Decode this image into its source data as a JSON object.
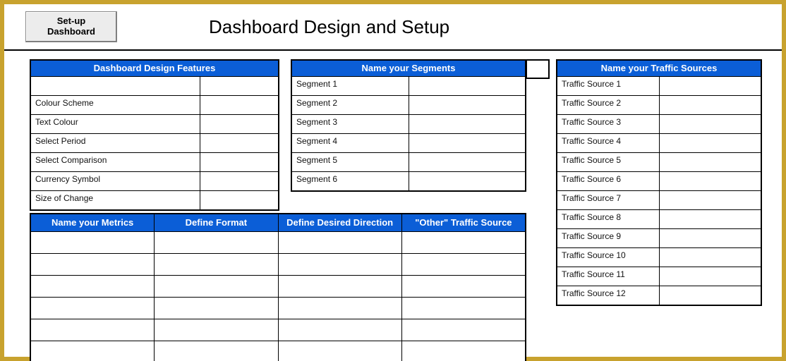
{
  "header": {
    "button_line1": "Set-up",
    "button_line2": "Dashboard",
    "title": "Dashboard Design and Setup"
  },
  "features": {
    "header": "Dashboard Design Features",
    "rows": [
      {
        "label": "",
        "value": ""
      },
      {
        "label": "Colour Scheme",
        "value": ""
      },
      {
        "label": "Text Colour",
        "value": ""
      },
      {
        "label": "Select Period",
        "value": ""
      },
      {
        "label": "Select Comparison",
        "value": ""
      },
      {
        "label": "Currency Symbol",
        "value": ""
      },
      {
        "label": "Size of Change",
        "value": ""
      }
    ]
  },
  "segments": {
    "header": "Name your Segments",
    "rows": [
      {
        "label": "Segment 1",
        "value": ""
      },
      {
        "label": "Segment 2",
        "value": ""
      },
      {
        "label": "Segment 3",
        "value": ""
      },
      {
        "label": "Segment 4",
        "value": ""
      },
      {
        "label": "Segment 5",
        "value": ""
      },
      {
        "label": "Segment 6",
        "value": ""
      }
    ]
  },
  "traffic": {
    "header": "Name your Traffic Sources",
    "rows": [
      {
        "label": "Traffic Source 1",
        "value": ""
      },
      {
        "label": "Traffic Source 2",
        "value": ""
      },
      {
        "label": "Traffic Source 3",
        "value": ""
      },
      {
        "label": "Traffic Source 4",
        "value": ""
      },
      {
        "label": "Traffic Source 5",
        "value": ""
      },
      {
        "label": "Traffic Source 6",
        "value": ""
      },
      {
        "label": "Traffic Source 7",
        "value": ""
      },
      {
        "label": "Traffic Source 8",
        "value": ""
      },
      {
        "label": "Traffic Source 9",
        "value": ""
      },
      {
        "label": "Traffic Source 10",
        "value": ""
      },
      {
        "label": "Traffic Source 11",
        "value": ""
      },
      {
        "label": "Traffic Source 12",
        "value": ""
      }
    ]
  },
  "metrics": {
    "headers": [
      "Name your Metrics",
      "Define Format",
      "Define Desired Direction",
      "\"Other\" Traffic Source"
    ],
    "row_count": 6
  }
}
